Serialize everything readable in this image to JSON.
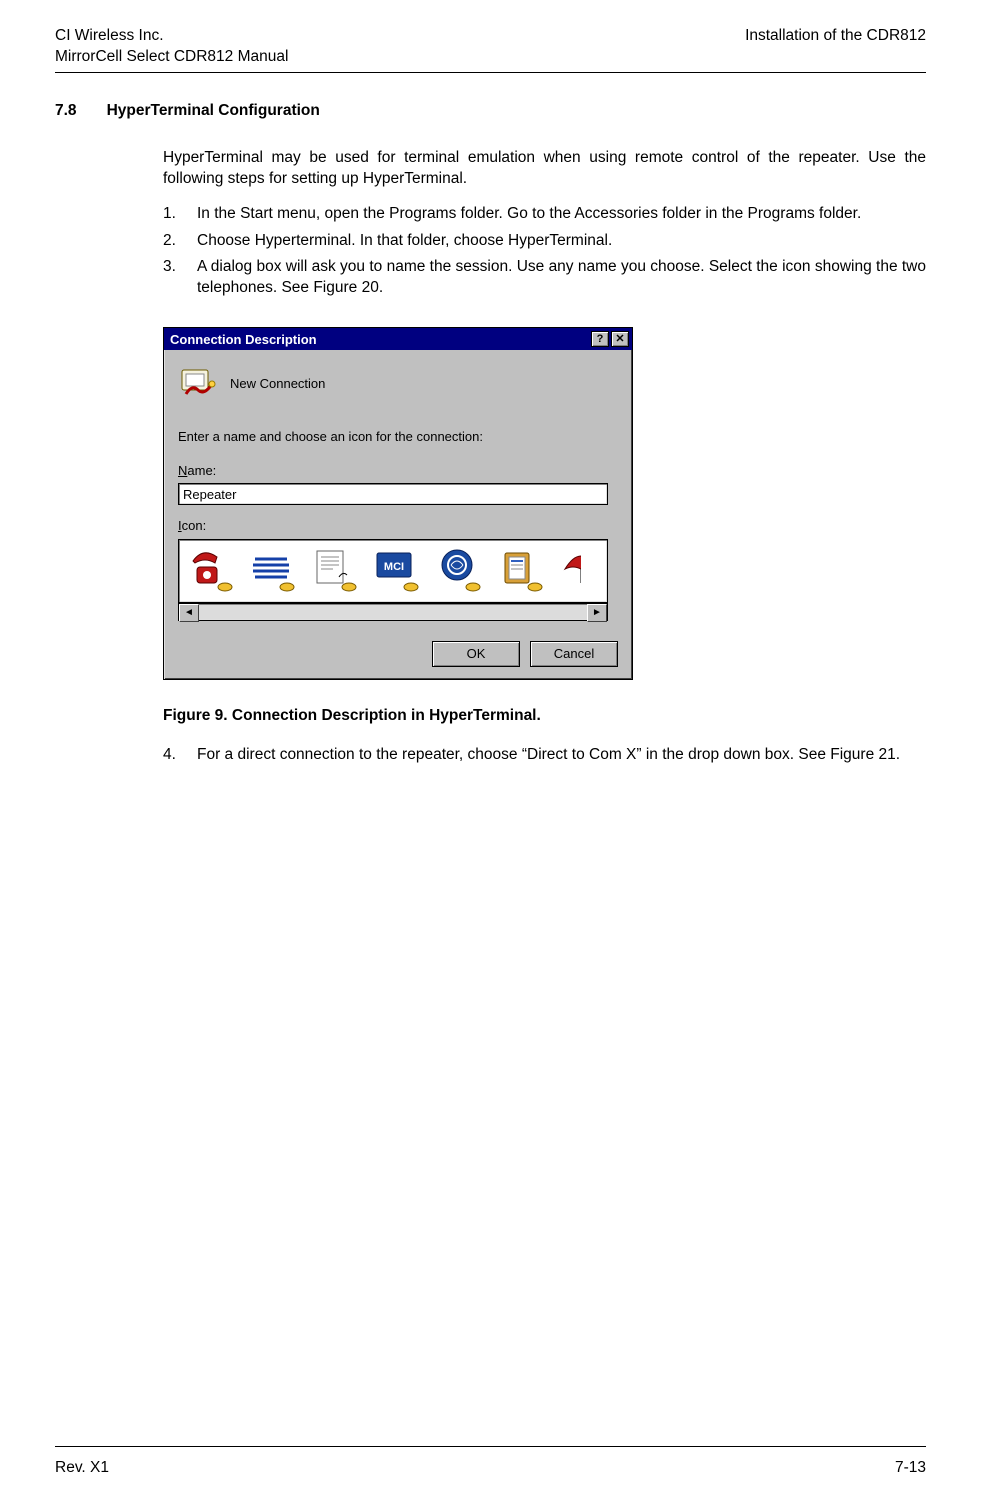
{
  "header": {
    "left_line1": "CI Wireless Inc.",
    "left_line2": "MirrorCell Select CDR812 Manual",
    "right_line1": "Installation of the CDR812"
  },
  "section": {
    "number": "7.8",
    "title": "HyperTerminal Configuration"
  },
  "intro": "HyperTerminal may be used for terminal emulation when using remote control of the repeater. Use the following steps for setting up HyperTerminal.",
  "steps_a": [
    {
      "n": "1.",
      "t": "In the Start menu, open the Programs folder. Go to the Accessories folder in the Programs folder."
    },
    {
      "n": "2.",
      "t": "Choose Hyperterminal. In that folder, choose HyperTerminal."
    },
    {
      "n": "3.",
      "t": "A dialog box will ask you to name the session. Use any name you choose. Select the icon showing the two telephones. See Figure 20."
    }
  ],
  "dialog": {
    "title": "Connection Description",
    "help_glyph": "?",
    "close_glyph": "✕",
    "top_label": "New Connection",
    "prompt": "Enter a name and choose an icon for the connection:",
    "name_label_pre": "N",
    "name_label_post": "ame:",
    "name_value": "Repeater",
    "icon_label_pre": "I",
    "icon_label_post": "con:",
    "scroll_left": "◄",
    "scroll_right": "►",
    "ok": "OK",
    "cancel": "Cancel",
    "icons": [
      "red-phone-icon",
      "att-globe-icon",
      "fax-paper-icon",
      "mci-icon",
      "ge-blue-circle-icon",
      "clipboard-doc-icon",
      "red-umbrella-icon"
    ]
  },
  "figure_caption": "Figure 9. Connection Description in HyperTerminal.",
  "steps_b": [
    {
      "n": "4.",
      "t": "For a direct connection to the repeater, choose “Direct to Com X” in the drop down box. See Figure 21."
    }
  ],
  "footer": {
    "left": "Rev. X1",
    "right": "7-13"
  }
}
